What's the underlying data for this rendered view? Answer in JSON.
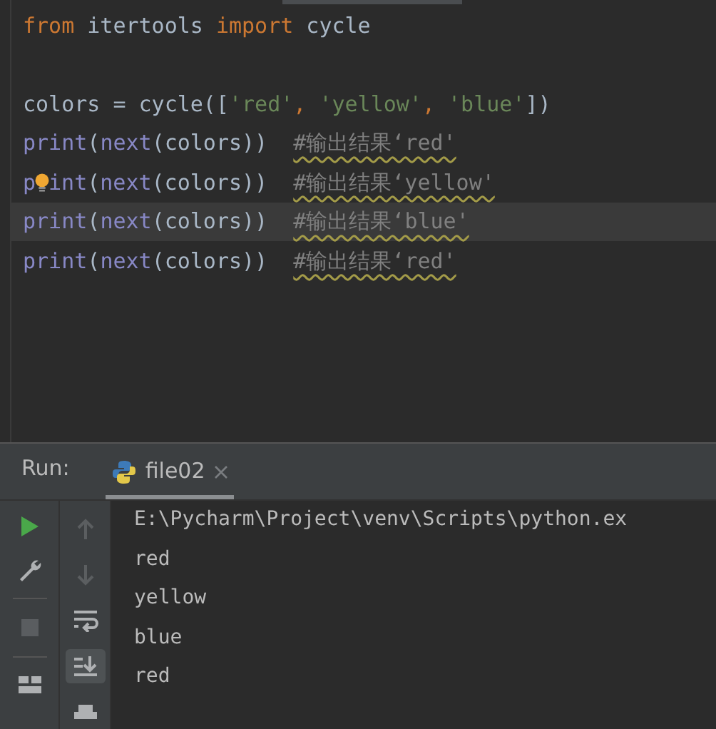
{
  "editor": {
    "lines": [
      {
        "current": false,
        "tokens": [
          {
            "kind": "keyword",
            "text": "from"
          },
          {
            "kind": "plain",
            "text": " itertools "
          },
          {
            "kind": "keyword",
            "text": "import"
          },
          {
            "kind": "plain",
            "text": " cycle"
          }
        ]
      },
      {
        "current": false
      },
      {
        "current": false,
        "tokens": [
          {
            "kind": "plain",
            "text": "colors = cycle(["
          },
          {
            "kind": "string",
            "text": "'red'"
          },
          {
            "kind": "keyword",
            "text": ", "
          },
          {
            "kind": "string",
            "text": "'yellow'"
          },
          {
            "kind": "keyword",
            "text": ", "
          },
          {
            "kind": "string",
            "text": "'blue'"
          },
          {
            "kind": "plain",
            "text": "])"
          }
        ]
      },
      {
        "current": false,
        "tokens": [
          {
            "kind": "builtin",
            "text": "print"
          },
          {
            "kind": "plain",
            "text": "("
          },
          {
            "kind": "builtin",
            "text": "next"
          },
          {
            "kind": "plain",
            "text": "(colors))  "
          },
          {
            "kind": "comment",
            "text": "#输出结果‘red'"
          }
        ]
      },
      {
        "current": false,
        "tokens": [
          {
            "kind": "builtin",
            "text": "p"
          },
          {
            "kind": "bulb"
          },
          {
            "kind": "builtin",
            "text": "int"
          },
          {
            "kind": "plain",
            "text": "("
          },
          {
            "kind": "builtin",
            "text": "next"
          },
          {
            "kind": "plain",
            "text": "(colors))  "
          },
          {
            "kind": "comment",
            "text": "#输出结果‘yellow'"
          }
        ]
      },
      {
        "current": true,
        "tokens": [
          {
            "kind": "builtin",
            "text": "print"
          },
          {
            "kind": "plain",
            "text": "("
          },
          {
            "kind": "builtin",
            "text": "next"
          },
          {
            "kind": "plain",
            "text": "(colors))  "
          },
          {
            "kind": "comment",
            "text": "#输出结果‘blue'"
          }
        ]
      },
      {
        "current": false,
        "tokens": [
          {
            "kind": "builtin",
            "text": "print"
          },
          {
            "kind": "plain",
            "text": "("
          },
          {
            "kind": "builtin",
            "text": "next"
          },
          {
            "kind": "plain",
            "text": "(colors))  "
          },
          {
            "kind": "comment",
            "text": "#输出结果‘red'"
          }
        ]
      }
    ]
  },
  "run_panel": {
    "label": "Run:",
    "tabs": [
      {
        "title": "file02",
        "selected": true
      }
    ],
    "output": [
      "E:\\Pycharm\\Project\\venv\\Scripts\\python.ex",
      "red",
      "yellow",
      "blue",
      "red"
    ],
    "tools": [
      {
        "kind": "up",
        "selected": false
      },
      {
        "kind": "down",
        "selected": false
      },
      {
        "kind": "wrap",
        "selected": false
      },
      {
        "kind": "scroll-end",
        "selected": true
      },
      {
        "kind": "print",
        "selected": false
      }
    ]
  }
}
